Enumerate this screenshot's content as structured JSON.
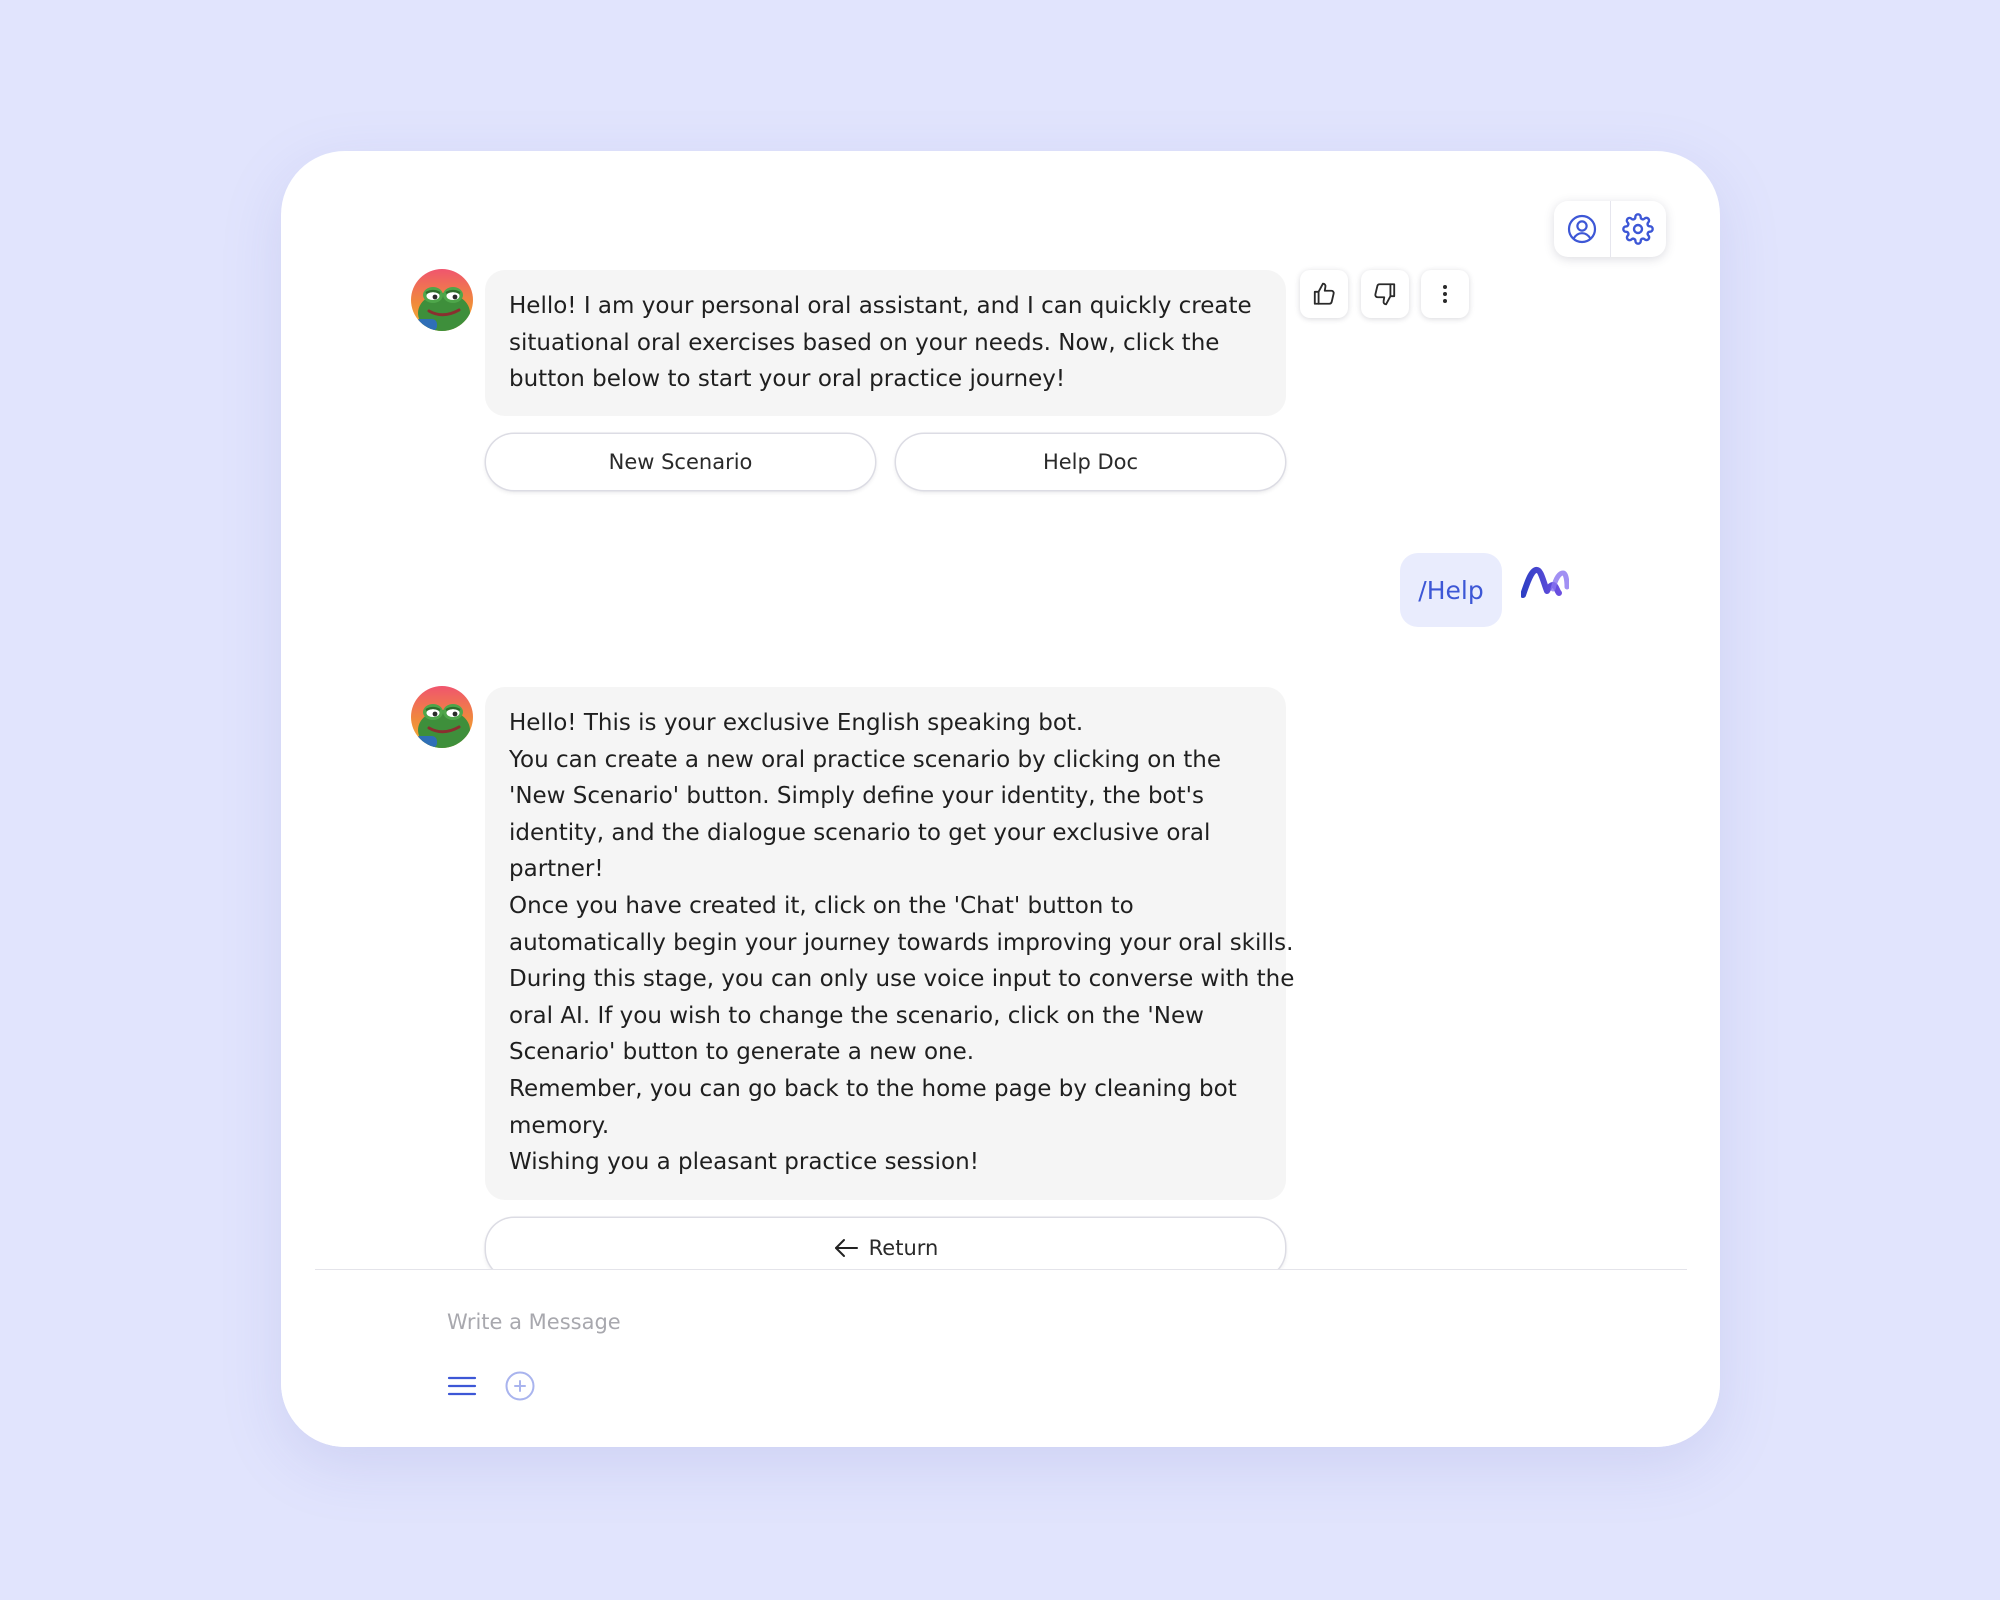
{
  "header": {
    "icons": [
      "user-circle-icon",
      "gear-icon"
    ]
  },
  "messages": [
    {
      "role": "bot",
      "avatar": "frog-avatar",
      "lines": [
        "Hello! I am your personal oral assistant, and I can quickly create",
        "situational oral exercises based on your needs. Now, click the",
        "button below to start your oral practice journey!"
      ],
      "buttons": [
        "New Scenario",
        "Help Doc"
      ],
      "feedback_icons": [
        "thumbs-up-icon",
        "thumbs-down-icon",
        "more-vertical-icon"
      ]
    },
    {
      "role": "user",
      "text": "/Help",
      "avatar": "brand-logo-icon"
    },
    {
      "role": "bot",
      "avatar": "frog-avatar",
      "lines": [
        "Hello! This is your exclusive English speaking bot.",
        "You can create a new oral practice scenario by clicking on the",
        "'New Scenario' button. Simply define your identity, the bot's",
        "identity, and the dialogue scenario to get your exclusive oral",
        "partner!",
        "Once you have created it, click on the 'Chat' button to",
        "automatically begin your journey towards improving your oral skills.",
        "During this stage, you can only use voice input to converse with the",
        "oral AI. If you wish to change the scenario, click on the 'New",
        "Scenario' button to generate a new one.",
        "Remember, you can go back to the home page by cleaning bot",
        "memory.",
        "Wishing you a pleasant practice session!"
      ],
      "buttons": [
        "Return"
      ]
    }
  ],
  "composer": {
    "placeholder": "Write a Message",
    "value": "",
    "icons": [
      "menu-icon",
      "add-circle-icon"
    ]
  },
  "colors": {
    "page_background": "#e1e4fd",
    "window_background": "#ffffff",
    "bot_bubble": "#f5f5f5",
    "user_bubble": "#e9ecfd",
    "accent": "#3d57d6",
    "text": "#1f1f1f",
    "placeholder": "#a8a8ae"
  }
}
